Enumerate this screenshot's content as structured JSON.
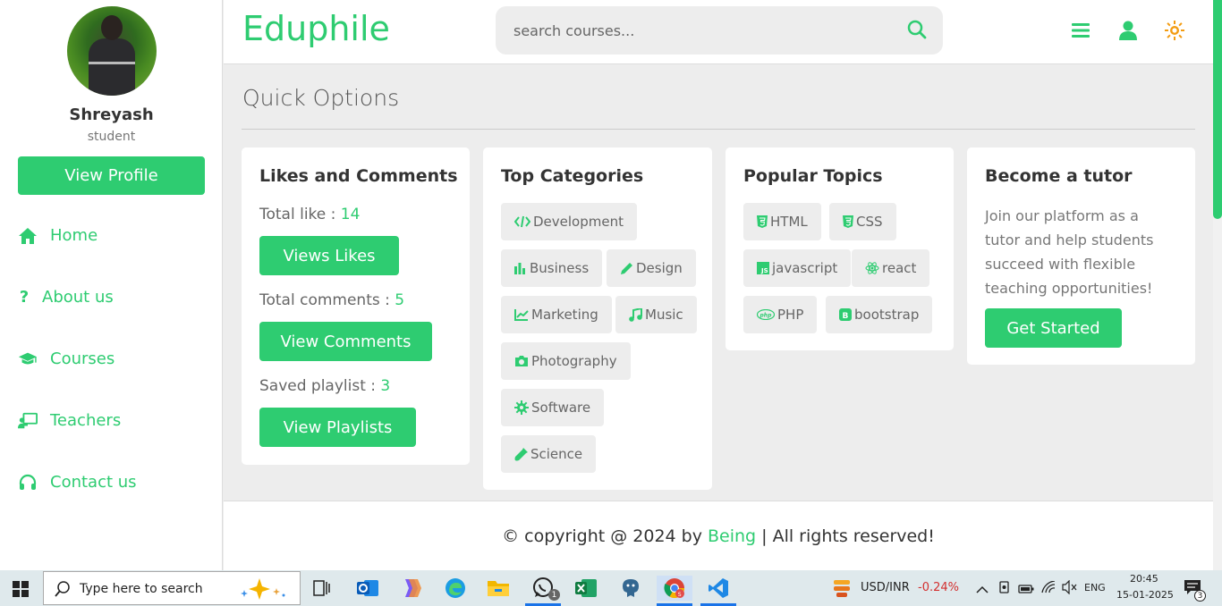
{
  "sidebar": {
    "profile": {
      "name": "Shreyash",
      "role": "student",
      "view_profile_label": "View Profile"
    },
    "nav": [
      {
        "label": "Home",
        "icon": "home-icon"
      },
      {
        "label": "About us",
        "icon": "question-icon"
      },
      {
        "label": "Courses",
        "icon": "graduation-cap-icon"
      },
      {
        "label": "Teachers",
        "icon": "chalkboard-teacher-icon"
      },
      {
        "label": "Contact us",
        "icon": "headset-icon"
      }
    ]
  },
  "header": {
    "logo": "Eduphile",
    "search_placeholder": "search courses...",
    "icons": [
      "menu-icon",
      "user-icon",
      "sun-icon"
    ]
  },
  "main": {
    "title": "Quick Options",
    "likes_card": {
      "title": "Likes and Comments",
      "total_like_label": "Total like : ",
      "total_like_value": "14",
      "views_likes_button": "Views Likes",
      "total_comments_label": "Total comments : ",
      "total_comments_value": "5",
      "view_comments_button": "View Comments",
      "saved_playlist_label": "Saved playlist : ",
      "saved_playlist_value": "3",
      "view_playlists_button": "View Playlists"
    },
    "categories_card": {
      "title": "Top Categories",
      "items": [
        {
          "label": "Development",
          "icon": "code-icon"
        },
        {
          "label": "Business",
          "icon": "bar-chart-icon"
        },
        {
          "label": "Design",
          "icon": "pen-icon"
        },
        {
          "label": "Marketing",
          "icon": "line-chart-icon"
        },
        {
          "label": "Music",
          "icon": "music-icon"
        },
        {
          "label": "Photography",
          "icon": "camera-icon"
        },
        {
          "label": "Software",
          "icon": "gear-icon"
        },
        {
          "label": "Science",
          "icon": "vial-icon"
        }
      ]
    },
    "topics_card": {
      "title": "Popular Topics",
      "items": [
        {
          "label": "HTML",
          "icon": "html5-icon"
        },
        {
          "label": "CSS",
          "icon": "css3-icon"
        },
        {
          "label": "javascript",
          "icon": "js-icon"
        },
        {
          "label": "react",
          "icon": "react-icon"
        },
        {
          "label": "PHP",
          "icon": "php-icon"
        },
        {
          "label": "bootstrap",
          "icon": "bootstrap-icon"
        }
      ]
    },
    "tutor_card": {
      "title": "Become a tutor",
      "text": "Join our platform as a tutor and help students succeed with flexible teaching opportunities!",
      "button": "Get Started"
    }
  },
  "footer": {
    "prefix": "© copyright @ 2024 by ",
    "brand": "Being",
    "suffix": " | All rights reserved!"
  },
  "taskbar": {
    "search_text": "Type here to search",
    "currency": "USD/INR",
    "currency_change": "-0.24%",
    "language": "ENG",
    "time": "20:45",
    "date": "15-01-2025",
    "whatsapp_badge": "1",
    "notification_badge": "3"
  },
  "colors": {
    "accent": "#2ecc71",
    "background": "#ededed",
    "negative": "#d32f2f",
    "sun": "#f39c12"
  }
}
